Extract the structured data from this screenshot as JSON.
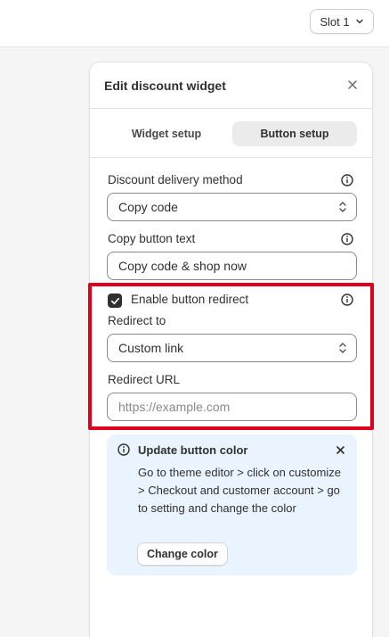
{
  "topbar": {
    "slot_label": "Slot 1"
  },
  "panel": {
    "title": "Edit discount widget",
    "tabs": [
      {
        "label": "Widget setup",
        "active": false
      },
      {
        "label": "Button setup",
        "active": true
      }
    ],
    "delivery": {
      "label": "Discount delivery method",
      "value": "Copy code"
    },
    "copy_text": {
      "label": "Copy button text",
      "value": "Copy code & shop now"
    },
    "redirect_enabled": {
      "label": "Enable button redirect",
      "checked": true
    },
    "redirect_to": {
      "label": "Redirect to",
      "value": "Custom link"
    },
    "redirect_url": {
      "label": "Redirect URL",
      "placeholder": "https://example.com",
      "value": ""
    },
    "banner": {
      "title": "Update button color",
      "text": "Go to theme editor > click on customize > Checkout and customer account > go to setting and change the color",
      "button_label": "Change color"
    }
  },
  "colors": {
    "highlight": "#e0001b",
    "banner_bg": "#eaf4ff",
    "checkbox": "#303030"
  }
}
